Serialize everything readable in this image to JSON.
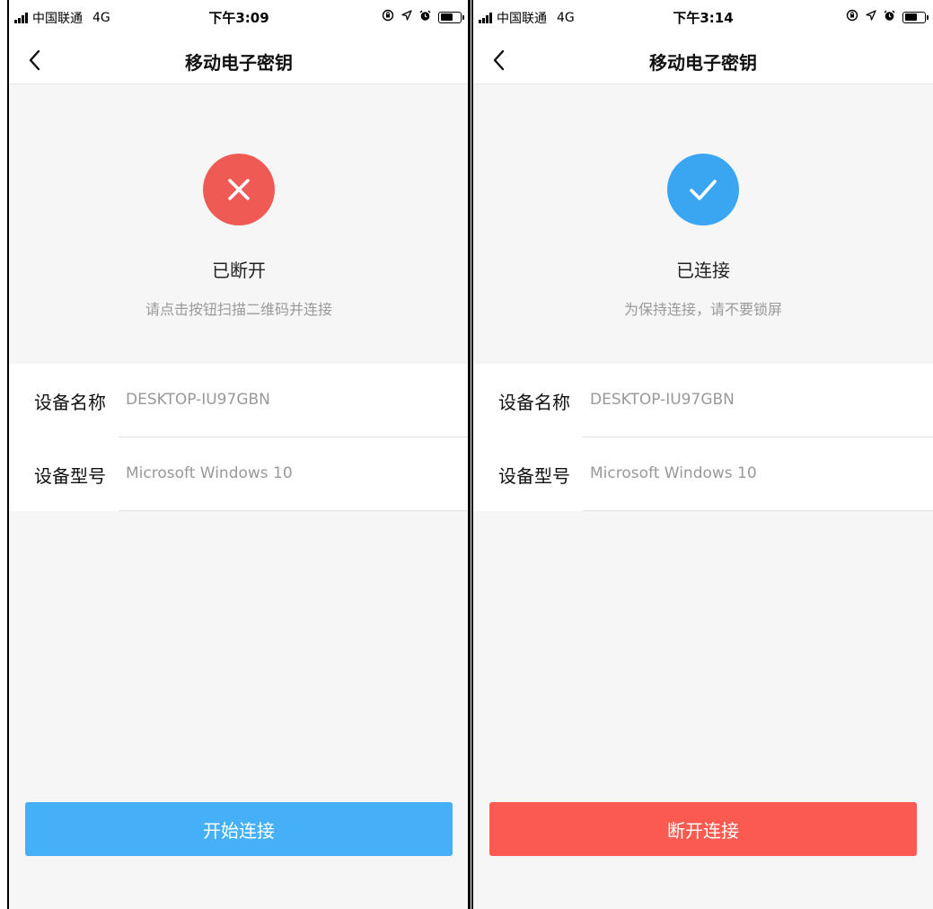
{
  "screens": [
    {
      "status_bar": {
        "carrier": "中国联通",
        "network": "4G",
        "time": "下午3:09",
        "icons": [
          "rotation-lock-icon",
          "location-icon",
          "alarm-icon",
          "battery-icon"
        ]
      },
      "nav": {
        "back_icon": "chevron-left-icon",
        "title": "移动电子密钥"
      },
      "state": {
        "icon": "close-icon",
        "icon_color": "#f05a55",
        "title": "已断开",
        "subtitle": "请点击按钮扫描二维码并连接"
      },
      "device": {
        "name_label": "设备名称",
        "name_value": "DESKTOP-IU97GBN",
        "model_label": "设备型号",
        "model_value": "Microsoft Windows 10"
      },
      "button": {
        "label": "开始连接",
        "color": "#45b0f8"
      }
    },
    {
      "status_bar": {
        "carrier": "中国联通",
        "network": "4G",
        "time": "下午3:14",
        "icons": [
          "rotation-lock-icon",
          "location-icon",
          "alarm-icon",
          "battery-icon"
        ]
      },
      "nav": {
        "back_icon": "chevron-left-icon",
        "title": "移动电子密钥"
      },
      "state": {
        "icon": "check-icon",
        "icon_color": "#3aa6f2",
        "title": "已连接",
        "subtitle": "为保持连接，请不要锁屏"
      },
      "device": {
        "name_label": "设备名称",
        "name_value": "DESKTOP-IU97GBN",
        "model_label": "设备型号",
        "model_value": "Microsoft Windows 10"
      },
      "button": {
        "label": "断开连接",
        "color": "#fa5a50"
      }
    }
  ]
}
